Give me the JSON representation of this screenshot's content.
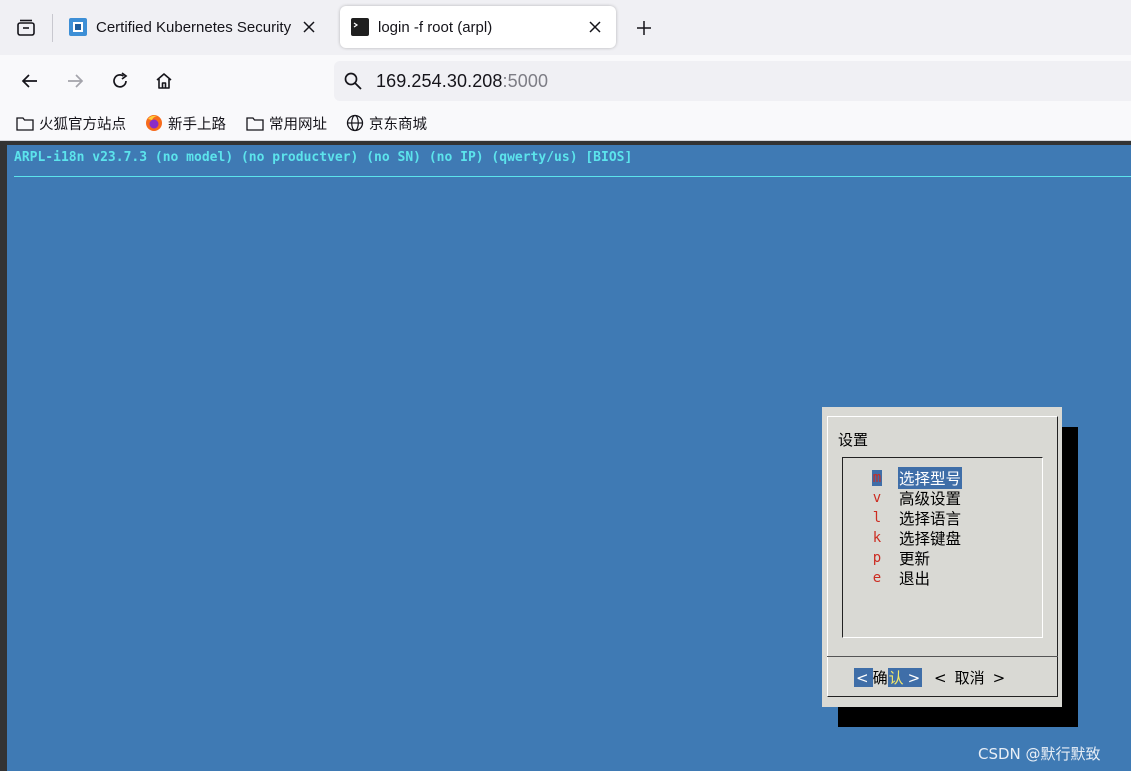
{
  "browser": {
    "tabs": [
      {
        "title": "Certified Kubernetes Security",
        "favicon": "kubernetes-cert-favicon",
        "active": false
      },
      {
        "title": "login -f root (arpl)",
        "favicon": "terminal-favicon",
        "active": true
      }
    ],
    "address": {
      "host": "169.254.30.208",
      "port": ":5000"
    },
    "bookmarks": [
      {
        "label": "火狐官方站点",
        "icon": "folder-icon"
      },
      {
        "label": "新手上路",
        "icon": "firefox-icon"
      },
      {
        "label": "常用网址",
        "icon": "folder-icon"
      },
      {
        "label": "京东商城",
        "icon": "globe-icon"
      }
    ]
  },
  "terminal": {
    "backtitle": "ARPL-i18n v23.7.3 (no model) (no productver) (no SN) (no IP) (qwerty/us) [BIOS]",
    "colors": {
      "background": "#3f7ab4",
      "backtitle": "#5ce4ec",
      "dialog": "#d9d9d4",
      "selection": "#3f6ea8",
      "hotkey": "#cc2b20"
    },
    "dialog": {
      "title": "设置",
      "items": [
        {
          "key": "m",
          "label": "选择型号",
          "selected": true
        },
        {
          "key": "v",
          "label": "高级设置",
          "selected": false
        },
        {
          "key": "l",
          "label": "选择语言",
          "selected": false
        },
        {
          "key": "k",
          "label": "选择键盘",
          "selected": false
        },
        {
          "key": "p",
          "label": "更新",
          "selected": false
        },
        {
          "key": "e",
          "label": "退出",
          "selected": false
        }
      ],
      "ok_button": {
        "open": "<",
        "first": "确",
        "second": "认",
        "close": ">"
      },
      "cancel_button": {
        "open": "<",
        "label": "取消",
        "close": ">"
      }
    }
  },
  "watermark": "CSDN @默行默致"
}
